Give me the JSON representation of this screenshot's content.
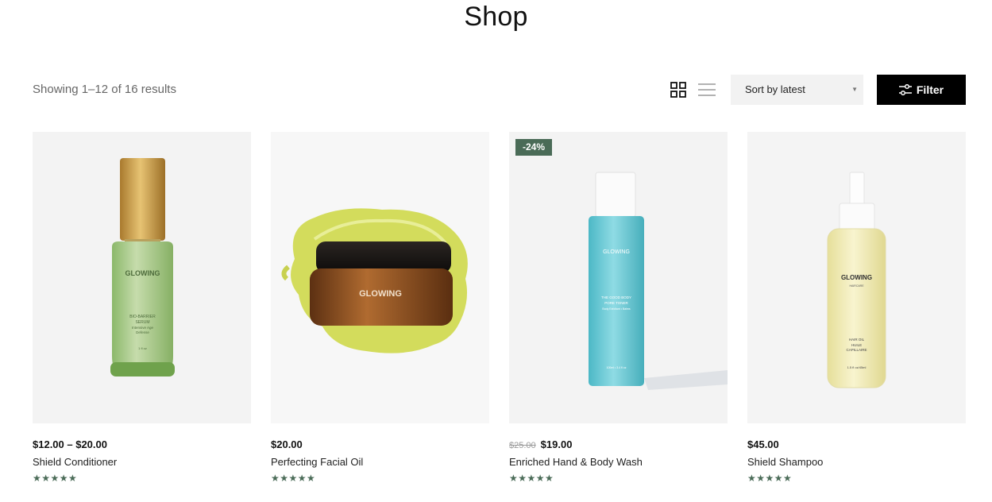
{
  "page": {
    "title": "Shop"
  },
  "toolbar": {
    "result_count": "Showing 1–12 of 16 results",
    "sort_value": "Sort by latest",
    "filter_label": "Filter"
  },
  "products": [
    {
      "price": "$12.00 – $20.00",
      "old_price": "",
      "name": "Shield Conditioner",
      "rating": "★★★★★",
      "badge": ""
    },
    {
      "price": "$20.00",
      "old_price": "",
      "name": "Perfecting Facial Oil",
      "rating": "★★★★★",
      "badge": ""
    },
    {
      "price": "$19.00",
      "old_price": "$25.00",
      "name": "Enriched Hand & Body Wash",
      "rating": "★★★★★",
      "badge": "-24%"
    },
    {
      "price": "$45.00",
      "old_price": "",
      "name": "Shield Shampoo",
      "rating": "★★★★★",
      "badge": ""
    }
  ],
  "product_images": {
    "brand": "GLOWING",
    "serum_lines": [
      "BIO-BARRIER",
      "SERUM",
      "Intensive Age",
      "Defense",
      "1 fl oz"
    ],
    "toner_lines": [
      "THE GOOD BODY",
      "PORE TONER",
      "Body Exfoliant • Balms",
      "100ml • 3.4 fl oz"
    ],
    "oil_lines": [
      "HAIRCARE",
      "HAIR OIL",
      "HUILE",
      "CAPILLAIRE",
      "1.5 fl oz/45ml"
    ]
  },
  "colors": {
    "badge_green": "#4a6b57",
    "star_green": "#4a6b57",
    "filter_bg": "#000000",
    "sort_bg": "#f2f2f2"
  },
  "icons": {
    "grid_view": "grid-icon",
    "list_view": "list-icon",
    "filter": "sliders-icon",
    "sort": "caret-down-icon"
  }
}
